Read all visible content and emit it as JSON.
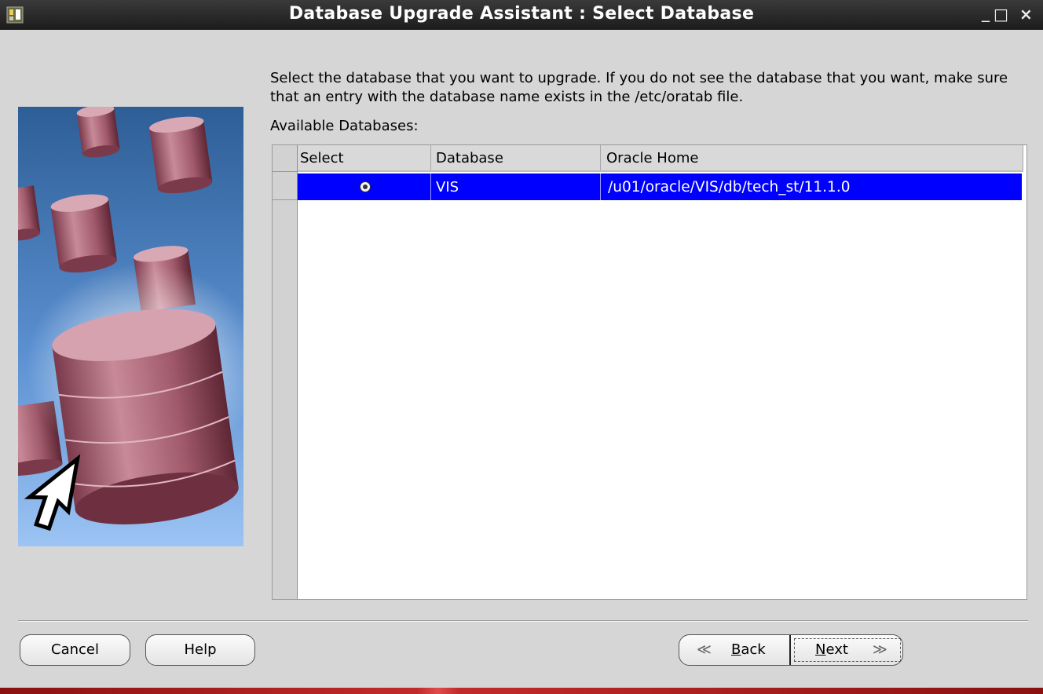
{
  "window": {
    "title": "Database Upgrade Assistant : Select Database",
    "minimize_glyph": "_",
    "maximize_glyph": "□",
    "close_glyph": "×"
  },
  "content": {
    "instruction": "Select the database that you want to upgrade. If you do not see the database that you want, make sure that an entry with the database name exists in the /etc/oratab file.",
    "available_label": "Available Databases:"
  },
  "table": {
    "columns": [
      "Select",
      "Database",
      "Oracle Home"
    ],
    "rows": [
      {
        "selected": true,
        "database": "VIS",
        "oracle_home": "/u01/oracle/VIS/db/tech_st/11.1.0"
      }
    ]
  },
  "buttons": {
    "cancel": "Cancel",
    "help": "Help",
    "back_mnemonic": "B",
    "back_rest": "ack",
    "next_mnemonic": "N",
    "next_rest": "ext",
    "back_icon": "≪",
    "next_icon": "≫"
  },
  "colors": {
    "selection": "#0000ff",
    "dialog_bg": "#d6d6d6",
    "titlebar": "#2a2a2a"
  },
  "icons": [
    "app-icon",
    "minimize-icon",
    "maximize-icon",
    "close-icon",
    "back-arrow-icon",
    "next-arrow-icon",
    "radio-selected-icon"
  ]
}
